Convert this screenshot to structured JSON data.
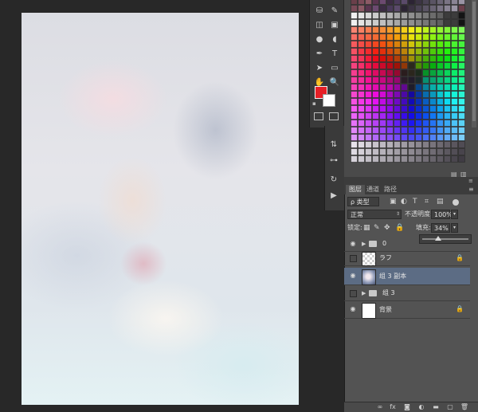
{
  "tools": {
    "icons": [
      "stamp-tool-icon",
      "history-brush-icon",
      "eraser-tool-icon",
      "gradient-tool-icon",
      "blur-tool-icon",
      "dodge-tool-icon",
      "pen-tool-icon",
      "type-tool-icon",
      "path-select-icon",
      "shape-tool-icon",
      "hand-tool-icon",
      "zoom-tool-icon"
    ],
    "glyphs": [
      "⛁",
      "✎",
      "◫",
      "▣",
      "●",
      "◖",
      "✒",
      "T",
      "➤",
      "▭",
      "✋",
      "🔍"
    ],
    "foreground_color": "#e61f26",
    "background_color": "#ffffff"
  },
  "mini_panel": {
    "glyphs": [
      "⇅",
      "⊶",
      "↻",
      "▶"
    ]
  },
  "swatch_palette": {
    "accent": "#ffcc00"
  },
  "layers_panel": {
    "tabs": [
      "图层",
      "通道",
      "路径"
    ],
    "filter_kind": "ρ 类型",
    "blend_mode": "正常",
    "opacity_label": "不透明度:",
    "opacity_value": "100%",
    "lock_label": "锁定:",
    "fill_label": "填充:",
    "fill_value": "34%",
    "fill_level": 0.34,
    "layers": [
      {
        "name": "0",
        "type": "folder",
        "visible": true,
        "selected": false
      },
      {
        "name": "ラフ",
        "type": "checker",
        "visible": false,
        "selected": false,
        "locked": true
      },
      {
        "name": "组 3 副本",
        "type": "image",
        "visible": true,
        "selected": true
      },
      {
        "name": "组 3",
        "type": "folder",
        "visible": false,
        "selected": false
      },
      {
        "name": "背景",
        "type": "white",
        "visible": true,
        "selected": false,
        "locked": true
      }
    ],
    "bottom_icons": [
      "link-icon",
      "fx-icon",
      "mask-icon",
      "adjustment-icon",
      "folder-icon",
      "new-layer-icon",
      "trash-icon"
    ],
    "bottom_glyphs": [
      "∞",
      "fx",
      "◙",
      "◐",
      "▬",
      "▢",
      "🗑"
    ]
  }
}
